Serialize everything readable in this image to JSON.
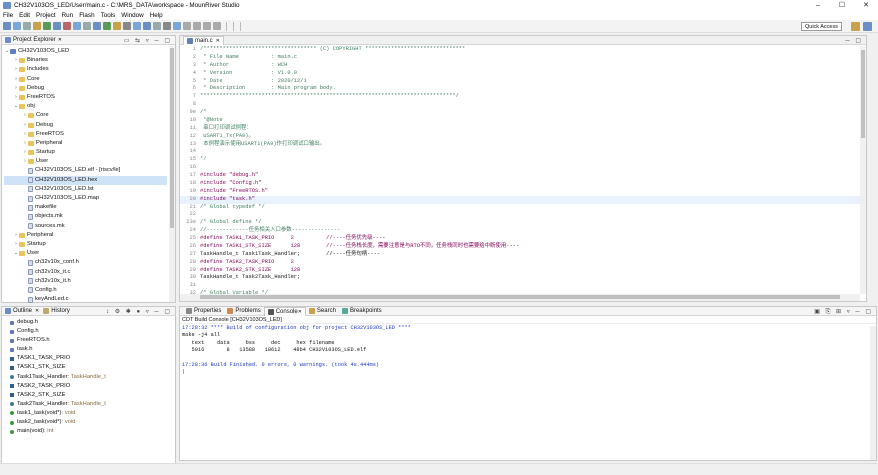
{
  "window": {
    "title": "CH32V103OS_LED/User/main.c - C:\\MRS_DATA\\workspace - MounRiver Studio",
    "min": "–",
    "max": "☐",
    "close": "✕"
  },
  "menu": [
    "File",
    "Edit",
    "Project",
    "Run",
    "Flash",
    "Tools",
    "Window",
    "Help"
  ],
  "toolbar": {
    "quick_access": "Quick Access"
  },
  "project_explorer": {
    "title": "Project Explorer",
    "items": [
      {
        "label": "CH32V103OS_LED",
        "type": "project",
        "open": true,
        "indent": 0
      },
      {
        "label": "Binaries",
        "type": "folder",
        "indent": 1
      },
      {
        "label": "Includes",
        "type": "folder",
        "indent": 1
      },
      {
        "label": "Core",
        "type": "folder",
        "indent": 1
      },
      {
        "label": "Debug",
        "type": "folder",
        "indent": 1
      },
      {
        "label": "FreeRTOS",
        "type": "folder",
        "indent": 1
      },
      {
        "label": "obj",
        "type": "folder",
        "open": true,
        "indent": 1
      },
      {
        "label": "Core",
        "type": "folder",
        "indent": 2
      },
      {
        "label": "Debug",
        "type": "folder",
        "indent": 2
      },
      {
        "label": "FreeRTOS",
        "type": "folder",
        "indent": 2
      },
      {
        "label": "Peripheral",
        "type": "folder",
        "indent": 2
      },
      {
        "label": "Startup",
        "type": "folder",
        "indent": 2
      },
      {
        "label": "User",
        "type": "folder",
        "indent": 2
      },
      {
        "label": "CH32V103OS_LED.elf - [riscv/le]",
        "type": "file",
        "indent": 2
      },
      {
        "label": "CH32V103OS_LED.hex",
        "type": "file",
        "indent": 2,
        "selected": true
      },
      {
        "label": "CH32V103OS_LED.lst",
        "type": "file",
        "indent": 2
      },
      {
        "label": "CH32V103OS_LED.map",
        "type": "file",
        "indent": 2
      },
      {
        "label": "makefile",
        "type": "file",
        "indent": 2
      },
      {
        "label": "objects.mk",
        "type": "file",
        "indent": 2
      },
      {
        "label": "sources.mk",
        "type": "file",
        "indent": 2
      },
      {
        "label": "Peripheral",
        "type": "folder",
        "indent": 1
      },
      {
        "label": "Startup",
        "type": "folder",
        "indent": 1
      },
      {
        "label": "User",
        "type": "folder",
        "open": true,
        "indent": 1
      },
      {
        "label": "ch32v10x_conf.h",
        "type": "file",
        "indent": 2
      },
      {
        "label": "ch32v10x_it.c",
        "type": "file",
        "indent": 2
      },
      {
        "label": "ch32v10x_it.h",
        "type": "file",
        "indent": 2
      },
      {
        "label": "Config.h",
        "type": "file",
        "indent": 2
      },
      {
        "label": "keyAndLed.c",
        "type": "file",
        "indent": 2
      }
    ]
  },
  "outline": {
    "tabs": [
      "Outline",
      "History"
    ],
    "items": [
      {
        "label": "debug.h",
        "kind": "include"
      },
      {
        "label": "Config.h",
        "kind": "include"
      },
      {
        "label": "FreeRTOS.h",
        "kind": "include"
      },
      {
        "label": "task.h",
        "kind": "include"
      },
      {
        "label": "TASK1_TASK_PRIO",
        "kind": "macro"
      },
      {
        "label": "TASK1_STK_SIZE",
        "kind": "macro"
      },
      {
        "label": "Task1Task_Handler",
        "type": " : TaskHandle_t",
        "kind": "var"
      },
      {
        "label": "TASK2_TASK_PRIO",
        "kind": "macro"
      },
      {
        "label": "TASK2_STK_SIZE",
        "kind": "macro"
      },
      {
        "label": "Task2Task_Handler",
        "type": " : TaskHandle_t",
        "kind": "var"
      },
      {
        "label": "task1_task(void*)",
        "type": " : void",
        "kind": "func"
      },
      {
        "label": "task2_task(void*)",
        "type": " : void",
        "kind": "func"
      },
      {
        "label": "main(void)",
        "type": " : int",
        "kind": "func"
      }
    ]
  },
  "editor": {
    "tab": "main.c",
    "lines": [
      {
        "n": "1",
        "t": "/*********************************** (C) COPYRIGHT *******************************",
        "c": "cm"
      },
      {
        "n": "2",
        "t": " * File Name          : main.c",
        "c": "cm"
      },
      {
        "n": "3",
        "t": " * Author             : WCH",
        "c": "cm"
      },
      {
        "n": "4",
        "t": " * Version            : V1.0.0",
        "c": "cm"
      },
      {
        "n": "5",
        "t": " * Date               : 2020/12/1",
        "c": "cm"
      },
      {
        "n": "6",
        "t": " * Description        : Main program body.",
        "c": "cm"
      },
      {
        "n": "7",
        "t": "*******************************************************************************/",
        "c": "cm"
      },
      {
        "n": "8",
        "t": "",
        "c": "cn"
      },
      {
        "n": "9⊖",
        "t": "/*",
        "c": "cm"
      },
      {
        "n": "10",
        "t": " *@Note",
        "c": "cm"
      },
      {
        "n": "11",
        "t": " 串口打印调试例程：",
        "c": "cm"
      },
      {
        "n": "12",
        "t": " USART1_Tx(PA9)。",
        "c": "cm"
      },
      {
        "n": "13",
        "t": " 本例程演示使用USART1(PA9)作打印调试口输出。",
        "c": "cm"
      },
      {
        "n": "14",
        "t": "",
        "c": "cn"
      },
      {
        "n": "15",
        "t": "*/",
        "c": "cm"
      },
      {
        "n": "16",
        "t": "",
        "c": "cn"
      },
      {
        "n": "17",
        "t": "#include \"debug.h\"",
        "c": "inc"
      },
      {
        "n": "18",
        "t": "#include \"Config.h\"",
        "c": "inc"
      },
      {
        "n": "19",
        "t": "#include \"FreeRTOS.h\"",
        "c": "inc"
      },
      {
        "n": "20",
        "t": "#include \"task.h\"",
        "c": "inc",
        "hl": true
      },
      {
        "n": "21",
        "t": "/* Global typedef */",
        "c": "cm"
      },
      {
        "n": "22",
        "t": "",
        "c": "cn"
      },
      {
        "n": "23⊖",
        "t": "/* Global define */",
        "c": "cm"
      },
      {
        "n": "24",
        "t": "//-------------任务相关入口参数---------------",
        "c": "cm"
      },
      {
        "n": "25",
        "t": "#define TASK1_TASK_PRIO     2          //----任务优先级----",
        "c": "def"
      },
      {
        "n": "26",
        "t": "#define TASK1_STK_SIZE      128        //----任务栈长度，需要注意是与RTO不同，任务栈同时也需要给中断使用----",
        "c": "def"
      },
      {
        "n": "27",
        "t": "TaskHandle_t Task1Task_Handler;        //----任务句柄----",
        "c": "var"
      },
      {
        "n": "28",
        "t": "#define TASK2_TASK_PRIO     2",
        "c": "def"
      },
      {
        "n": "29",
        "t": "#define TASK2_STK_SIZE      128",
        "c": "def"
      },
      {
        "n": "30",
        "t": "TaskHandle_t Task2Task_Handler;",
        "c": "cn"
      },
      {
        "n": "31",
        "t": "",
        "c": "cn"
      },
      {
        "n": "32",
        "t": "/* Global Variable */",
        "c": "cm"
      }
    ]
  },
  "bottom": {
    "tabs": [
      "Properties",
      "Problems",
      "Console",
      "Search",
      "Breakpoints"
    ],
    "console_title": "CDT Build Console [CH32V103OS_LED]",
    "lines": [
      {
        "t": "17:28:32 **** Build of configuration obj for project CH32V103OS_LED ****",
        "c": "blue"
      },
      {
        "t": "make -j4 all",
        "c": ""
      },
      {
        "t": "   text    data     bss     dec     hex filename",
        "c": ""
      },
      {
        "t": "   5016       8   13588   18612    48b4 CH32V103OS_LED.elf",
        "c": ""
      },
      {
        "t": "",
        "c": ""
      },
      {
        "t": "17:28:36 Build Finished. 0 errors, 0 warnings. (took 4s.444ms)",
        "c": "blue"
      }
    ]
  }
}
